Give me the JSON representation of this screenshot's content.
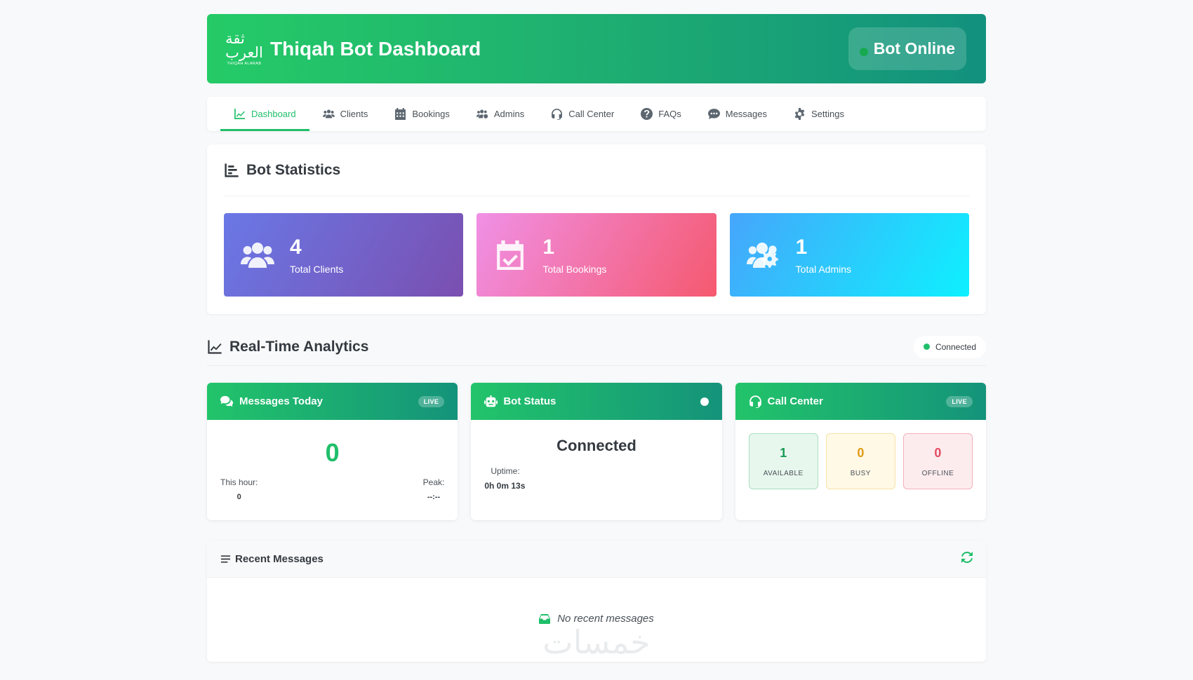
{
  "header": {
    "logo_arabic": "ثقة العرب",
    "logo_latin": "THIQAH ALARAB",
    "title": "Thiqah Bot Dashboard",
    "status": "Bot Online"
  },
  "nav": {
    "items": [
      {
        "label": "Dashboard",
        "icon": "chart-line-icon",
        "active": true
      },
      {
        "label": "Clients",
        "icon": "users-icon"
      },
      {
        "label": "Bookings",
        "icon": "calendar-icon"
      },
      {
        "label": "Admins",
        "icon": "users-cog-icon"
      },
      {
        "label": "Call Center",
        "icon": "headset-icon"
      },
      {
        "label": "FAQs",
        "icon": "question-circle-icon"
      },
      {
        "label": "Messages",
        "icon": "comment-dots-icon"
      },
      {
        "label": "Settings",
        "icon": "gear-icon"
      }
    ]
  },
  "stats": {
    "title": "Bot Statistics",
    "items": [
      {
        "value": "4",
        "label": "Total Clients",
        "icon": "users-icon"
      },
      {
        "value": "1",
        "label": "Total Bookings",
        "icon": "calendar-check-icon"
      },
      {
        "value": "1",
        "label": "Total Admins",
        "icon": "users-cog-icon"
      }
    ]
  },
  "analytics": {
    "title": "Real-Time Analytics",
    "connection": "Connected",
    "messages": {
      "title": "Messages Today",
      "badge": "LIVE",
      "count": "0",
      "hour_label": "This hour:",
      "hour_value": "0",
      "peak_label": "Peak:",
      "peak_value": "--:--"
    },
    "bot": {
      "title": "Bot Status",
      "state": "Connected",
      "uptime_label": "Uptime:",
      "uptime_value": "0h 0m 13s"
    },
    "call_center": {
      "title": "Call Center",
      "badge": "LIVE",
      "available_value": "1",
      "available_label": "AVAILABLE",
      "busy_value": "0",
      "busy_label": "BUSY",
      "offline_value": "0",
      "offline_label": "OFFLINE"
    }
  },
  "recent": {
    "title": "Recent Messages",
    "empty": "No recent messages",
    "watermark": "خمسات"
  },
  "colors": {
    "accent": "#1fbf6a",
    "header_gradient_start": "#25cb67",
    "header_gradient_end": "#12917e"
  }
}
